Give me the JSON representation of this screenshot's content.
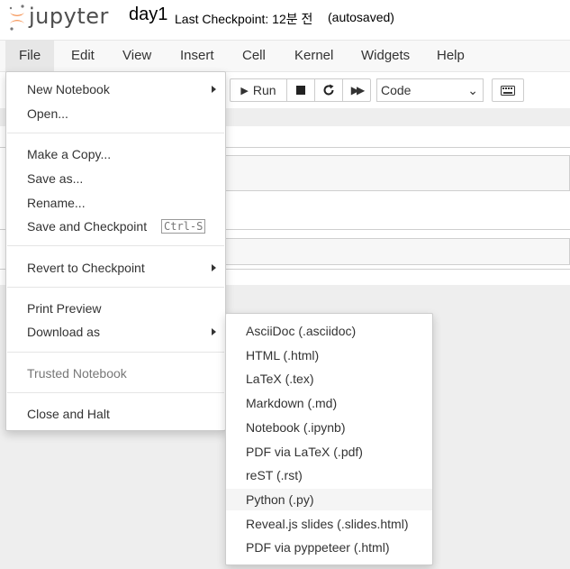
{
  "header": {
    "logo_text": "jupyter",
    "notebook_name": "day1",
    "checkpoint": "Last Checkpoint: 12분 전",
    "autosave": "(autosaved)"
  },
  "menubar": [
    "File",
    "Edit",
    "View",
    "Insert",
    "Cell",
    "Kernel",
    "Widgets",
    "Help"
  ],
  "toolbar": {
    "run_label": "Run",
    "cell_type": "Code"
  },
  "file_menu": {
    "new_notebook": "New Notebook",
    "open": "Open...",
    "make_copy": "Make a Copy...",
    "save_as": "Save as...",
    "rename": "Rename...",
    "save_checkpoint": "Save and Checkpoint",
    "save_shortcut": "Ctrl-S",
    "revert": "Revert to Checkpoint",
    "print_preview": "Print Preview",
    "download_as": "Download as",
    "trusted": "Trusted Notebook",
    "close_halt": "Close and Halt"
  },
  "download_menu": [
    "AsciiDoc (.asciidoc)",
    "HTML (.html)",
    "LaTeX (.tex)",
    "Markdown (.md)",
    "Notebook (.ipynb)",
    "PDF via LaTeX (.pdf)",
    "reST (.rst)",
    "Python (.py)",
    "Reveal.js slides (.slides.html)",
    "PDF via pyppeteer (.html)"
  ],
  "hovered_download_item": "Python (.py)"
}
